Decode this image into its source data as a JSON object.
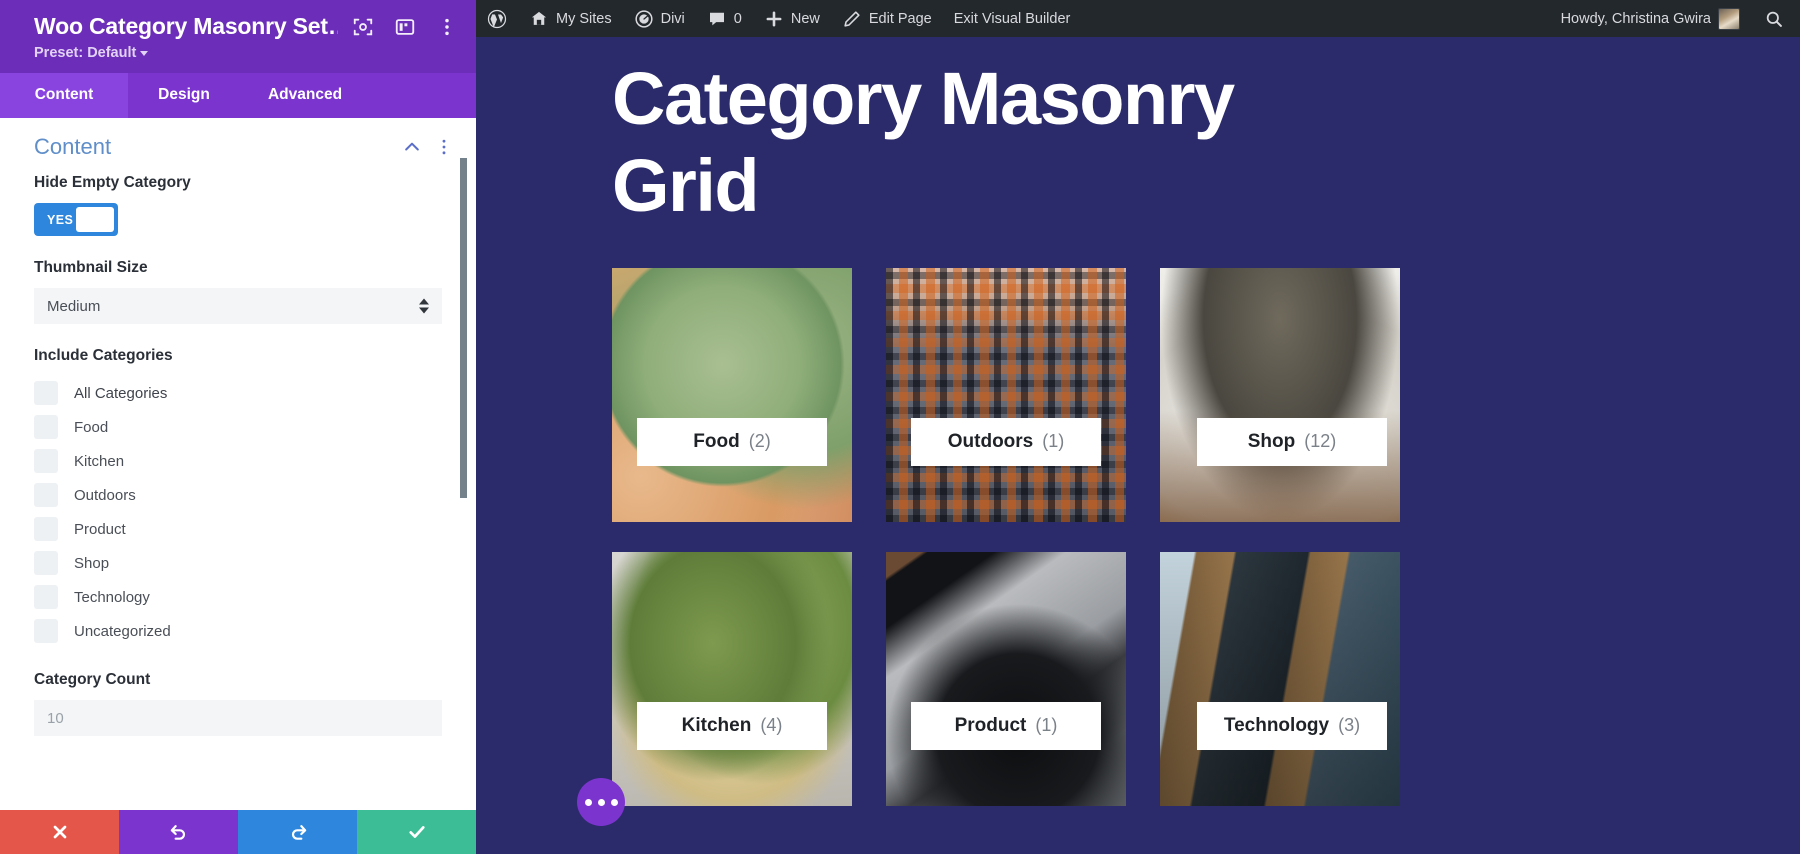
{
  "panel": {
    "title": "Woo Category Masonry Set…",
    "preset_label": "Preset: Default",
    "tabs": [
      {
        "label": "Content",
        "active": true
      },
      {
        "label": "Design",
        "active": false
      },
      {
        "label": "Advanced",
        "active": false
      }
    ],
    "section": {
      "title": "Content"
    },
    "fields": {
      "hide_empty_category": {
        "label": "Hide Empty Category",
        "toggle_value": "YES"
      },
      "thumbnail_size": {
        "label": "Thumbnail Size",
        "value": "Medium",
        "options": [
          "Medium"
        ]
      },
      "include_categories": {
        "label": "Include Categories",
        "items": [
          {
            "label": "All Categories",
            "checked": false
          },
          {
            "label": "Food",
            "checked": false
          },
          {
            "label": "Kitchen",
            "checked": false
          },
          {
            "label": "Outdoors",
            "checked": false
          },
          {
            "label": "Product",
            "checked": false
          },
          {
            "label": "Shop",
            "checked": false
          },
          {
            "label": "Technology",
            "checked": false
          },
          {
            "label": "Uncategorized",
            "checked": false
          }
        ]
      },
      "category_count": {
        "label": "Category Count",
        "value": "",
        "placeholder": "10"
      }
    },
    "actions": [
      {
        "name": "cancel",
        "icon": "close-icon",
        "color": "#e4564a"
      },
      {
        "name": "undo",
        "icon": "undo-icon",
        "color": "#7c34cf"
      },
      {
        "name": "redo",
        "icon": "redo-icon",
        "color": "#2e87dd"
      },
      {
        "name": "save",
        "icon": "check-icon",
        "color": "#3dbd95"
      }
    ]
  },
  "adminbar": {
    "items": [
      {
        "label": "",
        "icon": "wordpress-logo-icon"
      },
      {
        "label": "My Sites",
        "icon": "sites-icon"
      },
      {
        "label": "Divi",
        "icon": "divi-icon"
      },
      {
        "label": "0",
        "icon": "comment-icon"
      },
      {
        "label": "New",
        "icon": "plus-icon"
      },
      {
        "label": "Edit Page",
        "icon": "pencil-icon"
      },
      {
        "label": "Exit Visual Builder",
        "icon": ""
      }
    ],
    "greeting": "Howdy, Christina Gwira",
    "search_icon": "search-icon"
  },
  "canvas": {
    "page_title": "Category Masonry Grid",
    "background_color": "#2b2b6b",
    "cards": [
      {
        "name": "Food",
        "count": "(2)",
        "image": "artichokes-and-fruit"
      },
      {
        "name": "Outdoors",
        "count": "(1)",
        "image": "picnic-blanket-wine"
      },
      {
        "name": "Shop",
        "count": "(12)",
        "image": "living-room-interior"
      },
      {
        "name": "Kitchen",
        "count": "(4)",
        "image": "onion-and-leek"
      },
      {
        "name": "Product",
        "count": "(1)",
        "image": "laptop-and-headphones"
      },
      {
        "name": "Technology",
        "count": "(3)",
        "image": "media-console-room"
      }
    ],
    "fab": {
      "icon": "more-dots-icon",
      "color": "#7c34cf"
    }
  }
}
